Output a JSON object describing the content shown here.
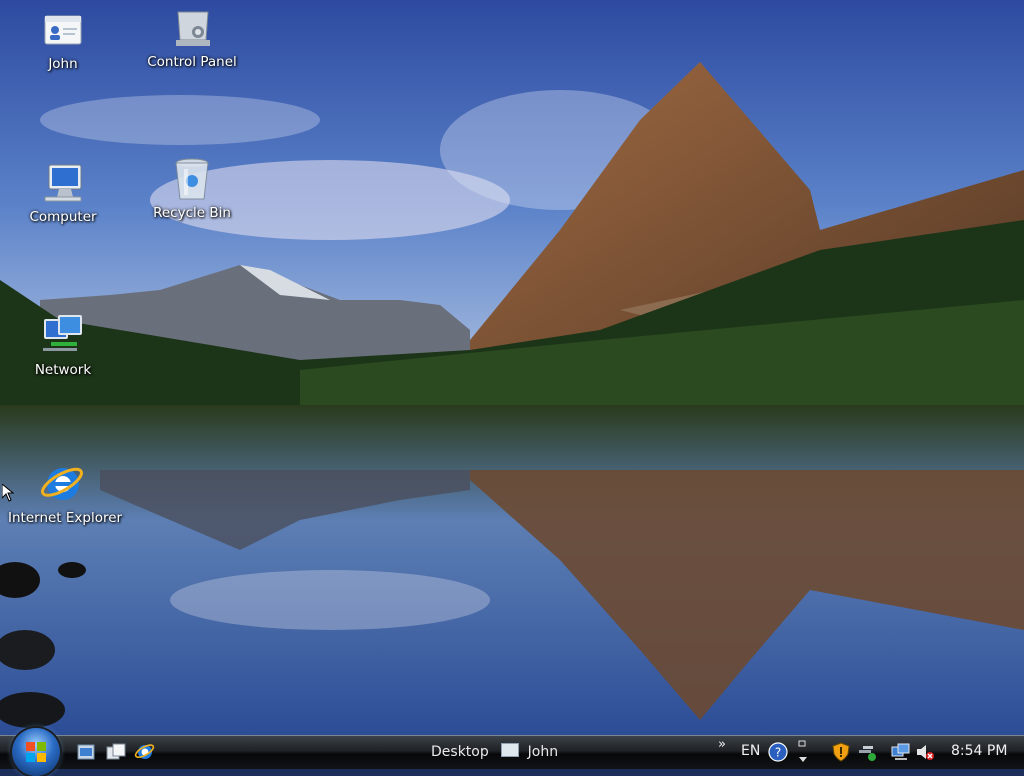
{
  "desktop": {
    "icons": [
      {
        "label": "John",
        "icon": "user-folder-icon"
      },
      {
        "label": "Control Panel",
        "icon": "control-panel-icon"
      },
      {
        "label": "Computer",
        "icon": "computer-icon"
      },
      {
        "label": "Recycle Bin",
        "icon": "recycle-bin-icon"
      },
      {
        "label": "Network",
        "icon": "network-icon"
      },
      {
        "label": "Internet Explorer",
        "icon": "internet-explorer-icon"
      }
    ]
  },
  "taskbar": {
    "toolbar_label": "Desktop",
    "toolbar_folder": "John",
    "chevron": "»",
    "language": "EN",
    "clock": "8:54 PM"
  },
  "colors": {
    "taskbar": "#1e2125",
    "label_text": "#ffffff",
    "start_orb": "#2a6bc4"
  }
}
